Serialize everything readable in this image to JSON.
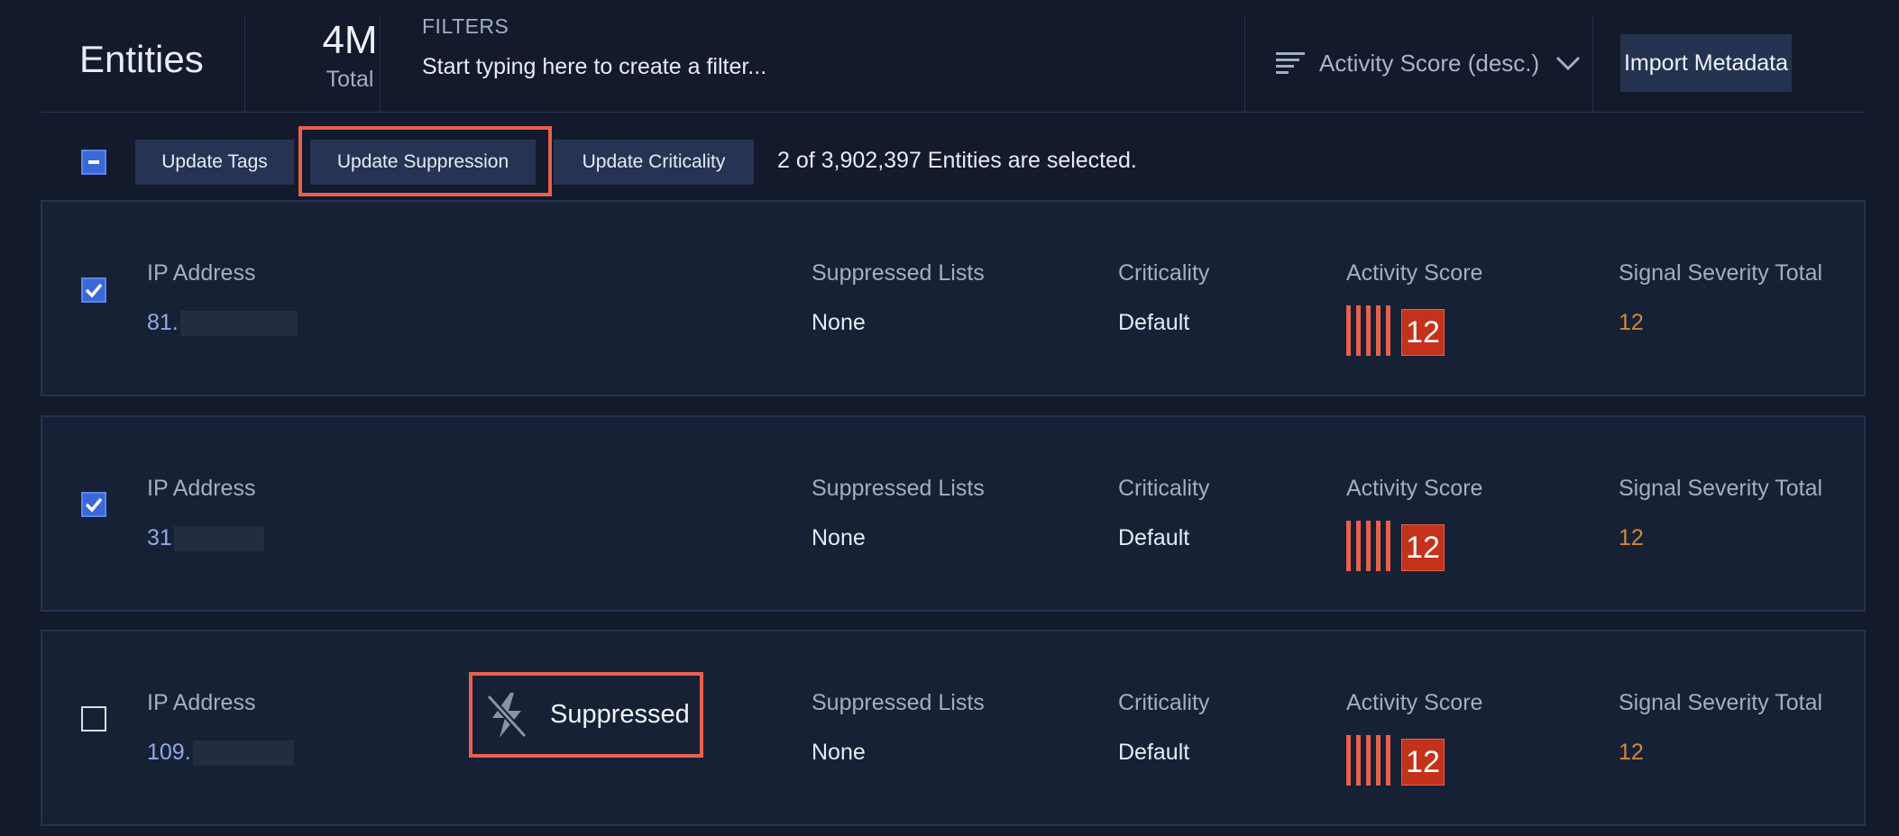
{
  "header": {
    "title": "Entities",
    "total_count": "4M",
    "total_label": "Total",
    "filters_label": "FILTERS",
    "filters_placeholder": "Start typing here to create a filter...",
    "sort_label": "Activity Score (desc.)",
    "sort_icon": "sort-lines-icon",
    "import_label": "Import Metadata"
  },
  "actionbar": {
    "select_all_state": "indeterminate",
    "buttons": [
      "Update Tags",
      "Update Suppression",
      "Update Criticality"
    ],
    "selection_text": "2 of 3,902,397 Entities are selected."
  },
  "columns": {
    "ip": "IP Address",
    "suppressed": "Suppressed Lists",
    "criticality": "Criticality",
    "activity": "Activity Score",
    "severity": "Signal Severity Total"
  },
  "rows": [
    {
      "checked": true,
      "ip": "81.",
      "suppressed": "None",
      "criticality": "Default",
      "activity_score": "12",
      "severity_total": "12",
      "suppressed_badge": ""
    },
    {
      "checked": true,
      "ip": "31",
      "suppressed": "None",
      "criticality": "Default",
      "activity_score": "12",
      "severity_total": "12",
      "suppressed_badge": ""
    },
    {
      "checked": false,
      "ip": "109.",
      "suppressed": "None",
      "criticality": "Default",
      "activity_score": "12",
      "severity_total": "12",
      "suppressed_badge": "Suppressed"
    }
  ],
  "colors": {
    "background": "#121a2b",
    "row_background": "#172136",
    "accent_blue": "#3a68d8",
    "score_red": "#c4321b",
    "highlight": "#e8604e",
    "severity_orange": "#d08a3a",
    "ip_link": "#93a9e3"
  }
}
